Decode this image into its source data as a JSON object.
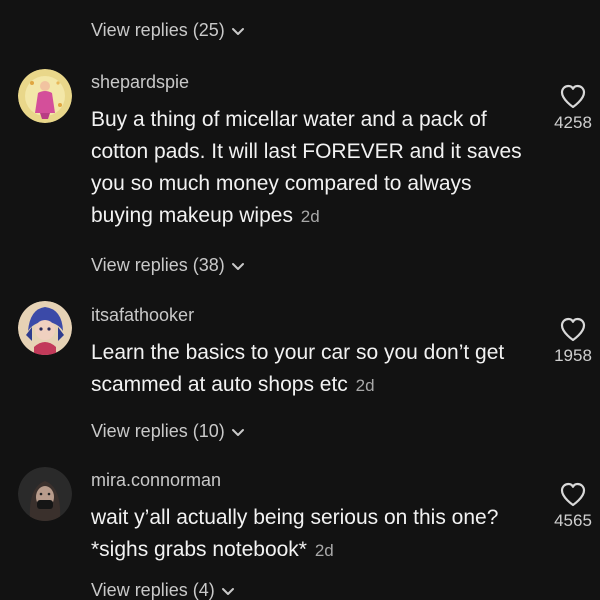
{
  "top_replies": {
    "label": "View replies (25)"
  },
  "comments": [
    {
      "username": "shepardspie",
      "text": "Buy a thing of micellar water and a pack of cotton pads. It will last FOREVER and it saves you so much money compared to always buying makeup wipes",
      "time": "2d",
      "likes": "4258",
      "replies_label": "View replies (38)"
    },
    {
      "username": "itsafathooker",
      "text": "Learn the basics to your car so you don’t get scammed at auto shops etc",
      "time": "2d",
      "likes": "1958",
      "replies_label": "View replies (10)"
    },
    {
      "username": "mira.connorman",
      "text": "wait y’all actually being serious on this one? *sighs grabs notebook*",
      "time": "2d",
      "likes": "4565",
      "replies_label": "View replies (4)"
    }
  ],
  "colors": {
    "background": "#121212",
    "text_primary": "#f2f2f2",
    "text_secondary": "#c8c8c8"
  },
  "icons": [
    "heart-icon",
    "chevron-down-icon"
  ]
}
